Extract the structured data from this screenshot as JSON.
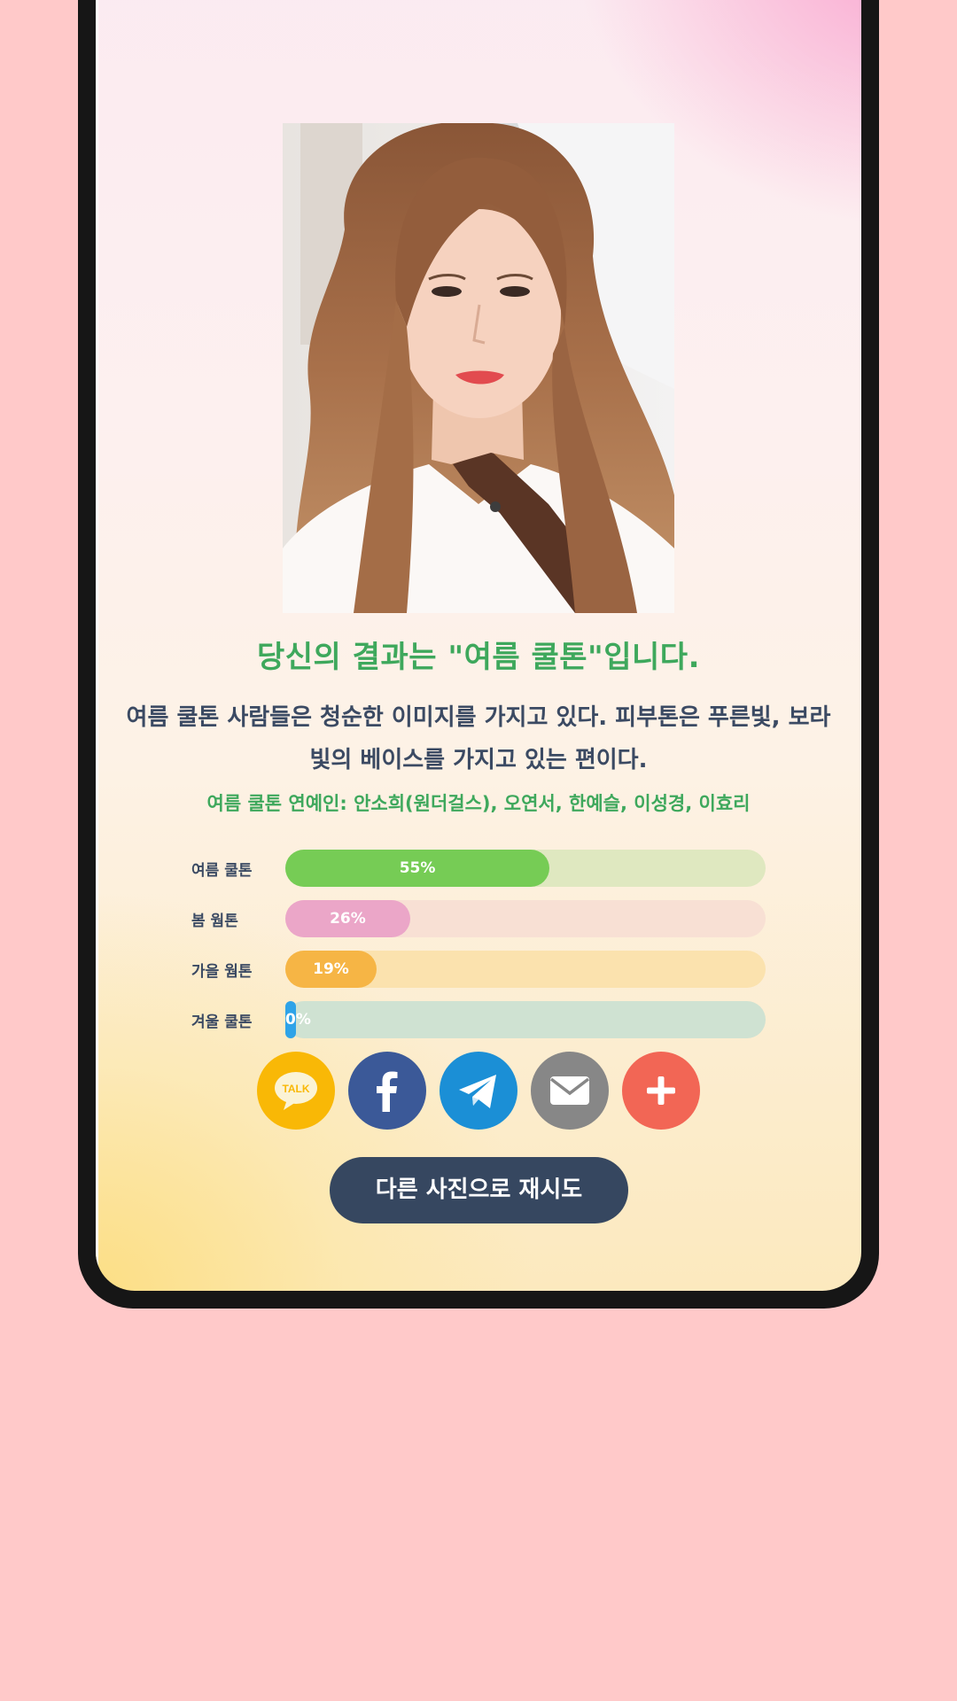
{
  "result": {
    "title": "당신의 결과는 \"여름 쿨톤\"입니다.",
    "description": "여름 쿨톤 사람들은 청순한 이미지를 가지고 있다. 피부톤은 푸른빛, 보라빛의 베이스를 가지고 있는 편이다.",
    "celebrities": "여름 쿨톤 연예인: 안소희(원더걸스), 오연서, 한예슬, 이성경, 이효리"
  },
  "scores": [
    {
      "label": "여름 쿨톤",
      "percent": 55,
      "text": "55%",
      "color": "#76cc55",
      "track": "#dfe8c0"
    },
    {
      "label": "봄 웜톤",
      "percent": 26,
      "text": "26%",
      "color": "#eba6c8",
      "track": "#f8e0d4"
    },
    {
      "label": "가을 웜톤",
      "percent": 19,
      "text": "19%",
      "color": "#f6b545",
      "track": "#fbe2ae"
    },
    {
      "label": "겨울 쿨톤",
      "percent": 0,
      "text": "0%",
      "color": "#2ea3e8",
      "track": "#cfe2d2"
    }
  ],
  "share": [
    {
      "name": "kakaotalk-share",
      "icon": "talk-bubble-icon",
      "color": "#f9b806",
      "icon_text": "TALK"
    },
    {
      "name": "facebook-share",
      "icon": "facebook-f-icon",
      "color": "#3b5998"
    },
    {
      "name": "telegram-share",
      "icon": "paper-plane-icon",
      "color": "#1b8fd6"
    },
    {
      "name": "email-share",
      "icon": "envelope-icon",
      "color": "#878787"
    },
    {
      "name": "more-share",
      "icon": "plus-icon",
      "color": "#f26655"
    }
  ],
  "retry_label": "다른 사진으로 재시도"
}
